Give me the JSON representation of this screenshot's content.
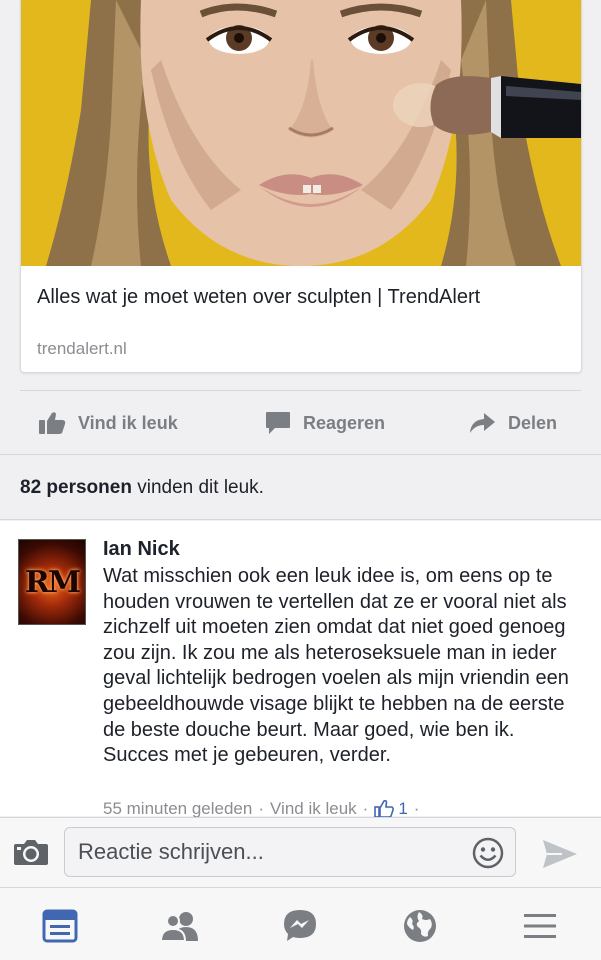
{
  "link_preview": {
    "title": "Alles wat je moet weten over sculpten | TrendAlert",
    "domain": "trendalert.nl"
  },
  "actions": {
    "like_label": "Vind ik leuk",
    "comment_label": "Reageren",
    "share_label": "Delen"
  },
  "likes": {
    "count": "82 personen",
    "suffix": " vinden dit leuk."
  },
  "comment": {
    "author": "Ian Nick",
    "avatar_text": "RM",
    "text": "Wat misschien ook een leuk idee is, om eens op te houden vrouwen te vertellen dat ze er vooral niet als zichzelf uit moeten zien omdat dat niet goed genoeg zou zijn. Ik zou me als heteroseksuele man in ieder geval lichtelijk bedrogen voelen als mijn vriendin een gebeeldhouwde visage blijkt te hebben na de eerste de beste douche beurt. Maar goed, wie ben ik. Succes met je gebeuren, verder.",
    "time": "55 minuten geleden",
    "like_label": "Vind ik leuk",
    "like_count": "1",
    "separator": "·"
  },
  "composer": {
    "placeholder": "Reactie schrijven..."
  },
  "tabs": [
    {
      "icon": "news-feed-icon",
      "active": true
    },
    {
      "icon": "friends-icon",
      "active": false
    },
    {
      "icon": "messenger-icon",
      "active": false
    },
    {
      "icon": "globe-icon",
      "active": false
    },
    {
      "icon": "menu-icon",
      "active": false
    }
  ],
  "colors": {
    "brand_blue": "#4267b2",
    "icon_gray": "#7b7e83",
    "image_background": "#e3b81c"
  }
}
